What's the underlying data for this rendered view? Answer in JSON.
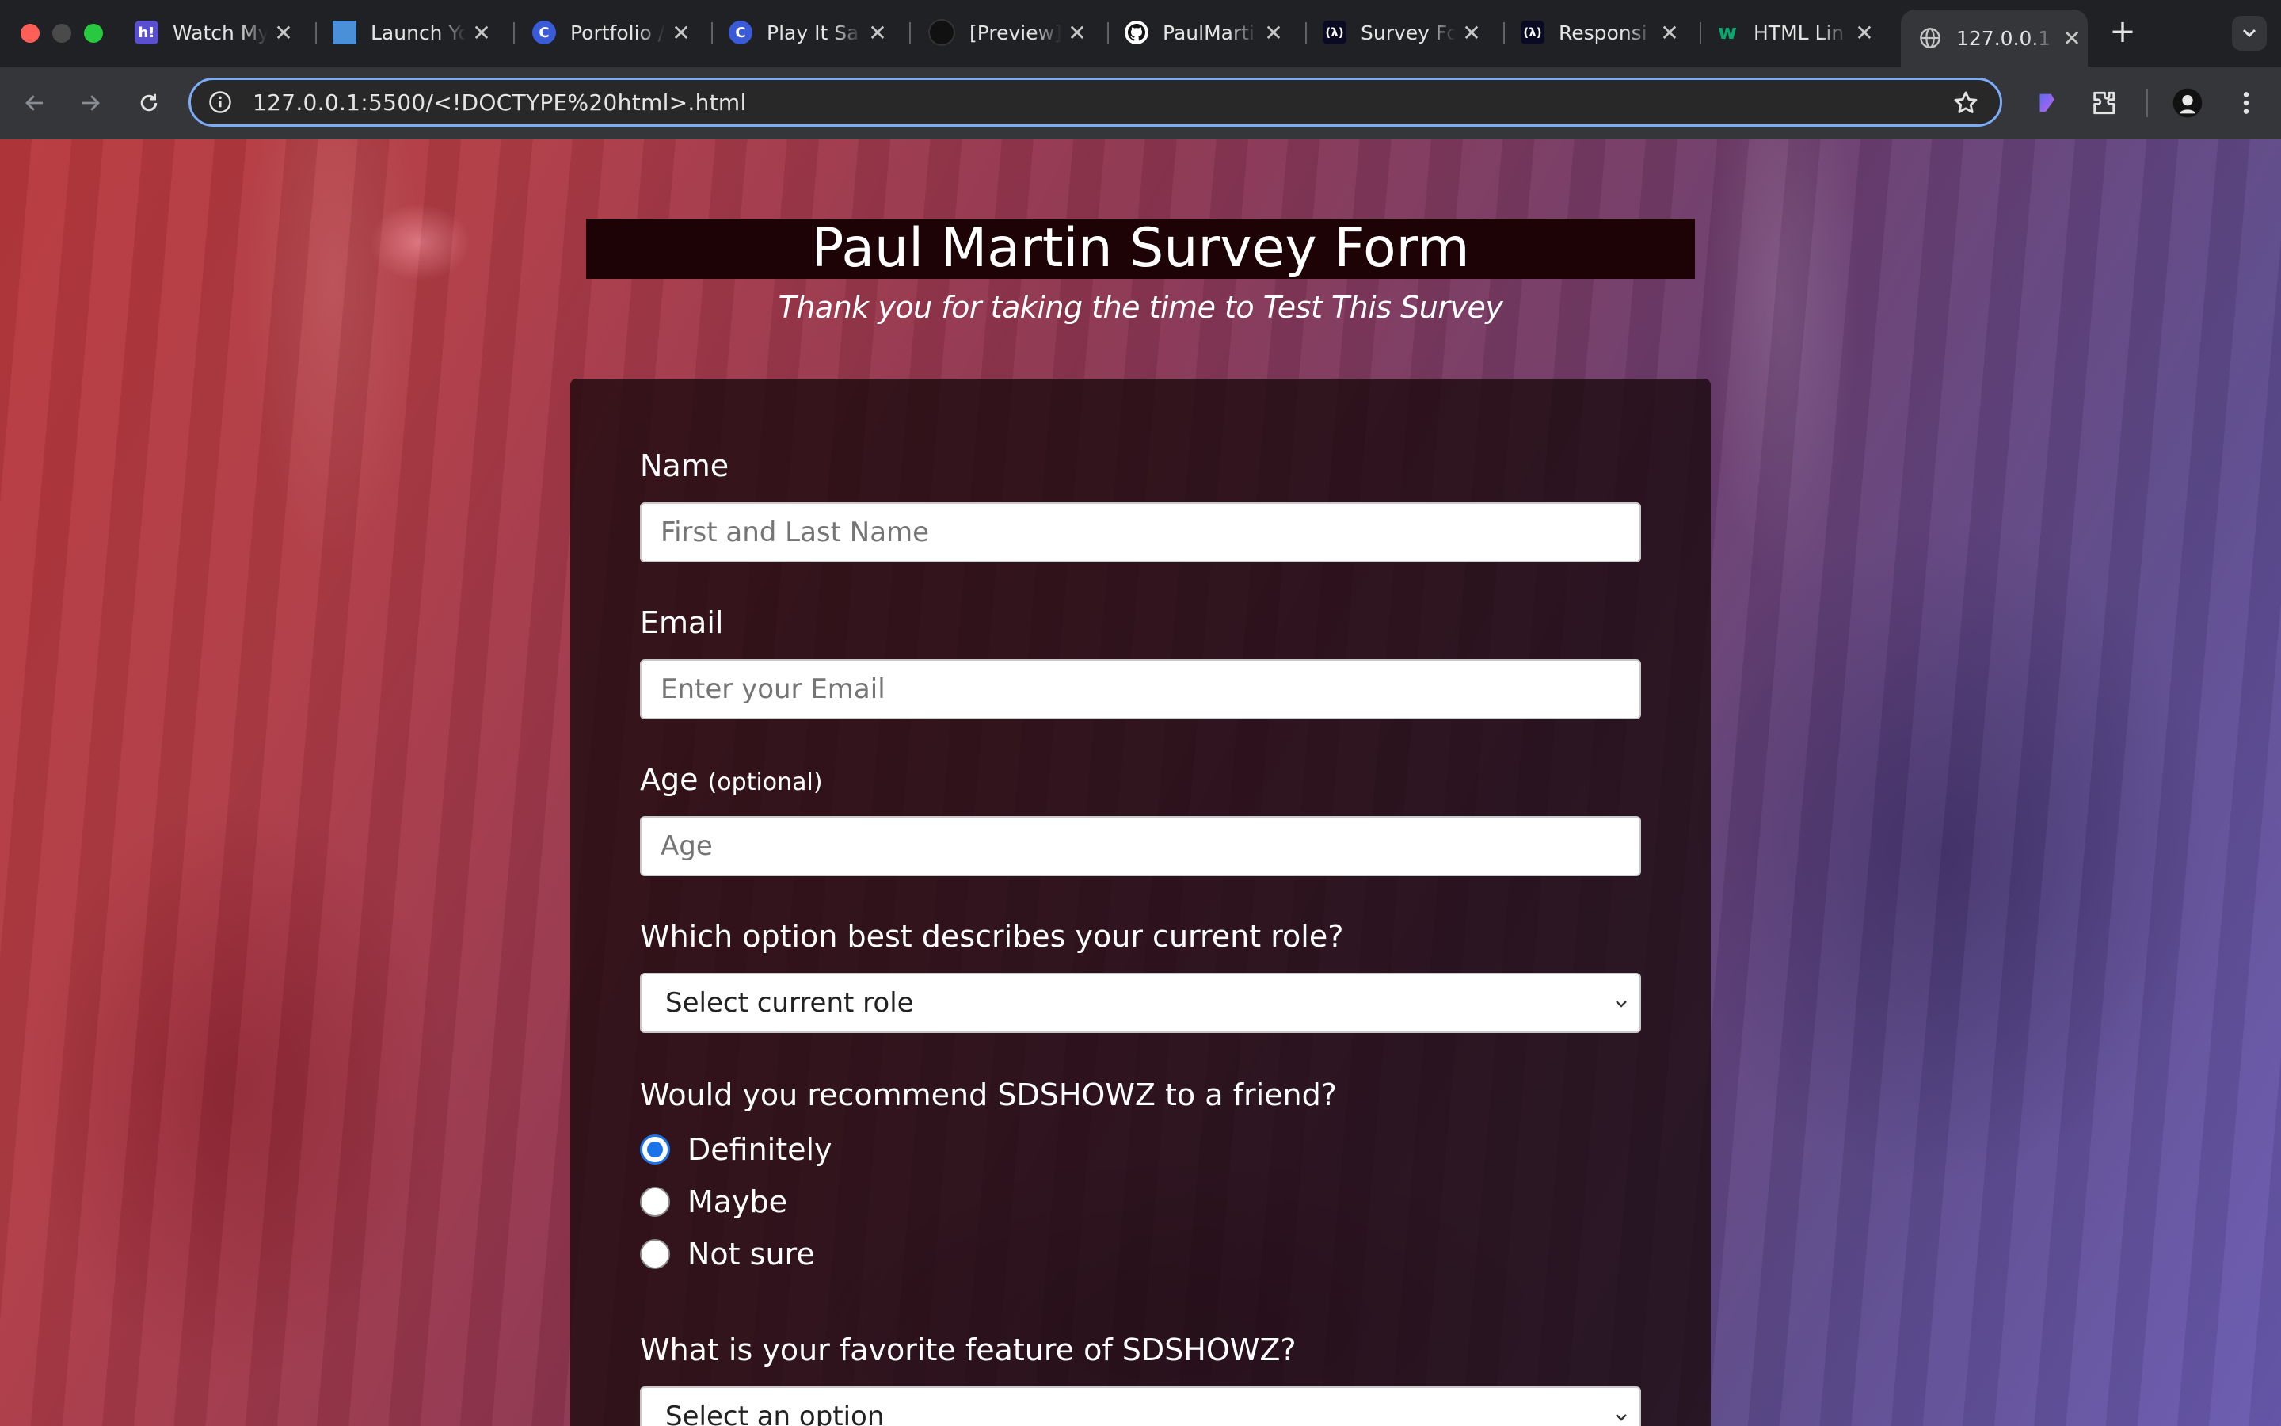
{
  "browser": {
    "tabs": [
      {
        "title": "Watch My",
        "favicon": "hi-icon",
        "favicon_text": "h!",
        "favicon_color": "#5a4fcf"
      },
      {
        "title": "Launch Yo",
        "favicon": "launch-icon",
        "favicon_color": "#4a90d9"
      },
      {
        "title": "Portfolio /",
        "favicon": "codecademy-icon",
        "favicon_text": "C",
        "favicon_color": "#3a5bd9"
      },
      {
        "title": "Play It Sa",
        "favicon": "codecademy-icon",
        "favicon_text": "C",
        "favicon_color": "#3a5bd9"
      },
      {
        "title": "[Preview]",
        "favicon": "github-icon",
        "favicon_color": "#222222"
      },
      {
        "title": "PaulMarti",
        "favicon": "github-icon",
        "favicon_color": "#ffffff"
      },
      {
        "title": "Survey Fo",
        "favicon": "freecodecamp-icon",
        "favicon_text": "(λ)",
        "favicon_color": "#0a0a23"
      },
      {
        "title": "Responsi",
        "favicon": "freecodecamp-icon",
        "favicon_text": "(λ)",
        "favicon_color": "#0a0a23"
      },
      {
        "title": "HTML Lin",
        "favicon": "w3schools-icon",
        "favicon_text": "w",
        "favicon_color": "#04aa6d"
      },
      {
        "title": "127.0.0.1",
        "favicon": "globe-icon",
        "active": true
      }
    ],
    "url": "127.0.0.1:5500/<!DOCTYPE%20html>.html"
  },
  "page": {
    "title": "Paul Martin Survey Form",
    "subtitle": "Thank you for taking the time to Test This Survey",
    "form": {
      "name_label": "Name",
      "name_placeholder": "First and Last Name",
      "email_label": "Email",
      "email_placeholder": "Enter your Email",
      "age_label": "Age",
      "age_optional": "(optional)",
      "age_placeholder": "Age",
      "role_label": "Which option best describes your current role?",
      "role_selected": "Select current role",
      "recommend_label": "Would you recommend SDSHOWZ to a friend?",
      "recommend_options": [
        "Definitely",
        "Maybe",
        "Not sure"
      ],
      "recommend_selected": "Definitely",
      "feature_label": "What is your favorite feature of SDSHOWZ?",
      "feature_selected": "Select an option"
    }
  },
  "colors": {
    "title_bg": "#1d0305",
    "radio_accent": "#1a73e8",
    "omnibox_focus": "#7cacf8"
  }
}
